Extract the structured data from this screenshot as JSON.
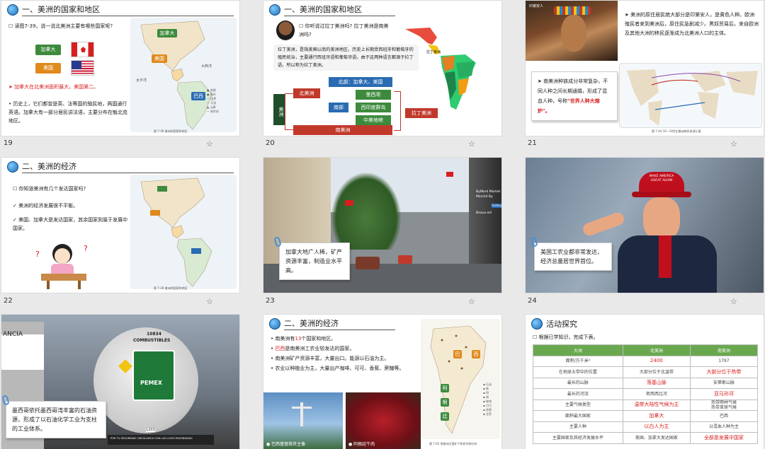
{
  "slides": [
    {
      "num": "19",
      "title": "一、美洲的国家和地区",
      "q": "读图7-39，说一说北美洲主要有哪些国家呢?",
      "labels": [
        "加拿大",
        "美国"
      ],
      "point1": "➤ 加拿大在北美洲面积最大，美国第二。",
      "point2": "历史上，它们都曾是英、法等国的殖民地，两国通行英语。加拿大有一部分居民讲法语，主要分布在魁北克地区。",
      "caption": "图 7-39   美洲的国家和地区",
      "map_labels": [
        "加拿大",
        "美国",
        "巴西"
      ]
    },
    {
      "num": "20",
      "title": "一、美洲的国家和地区",
      "q": "你听说过拉丁美洲吗? 拉丁美洲是南美洲吗?",
      "para": "拉丁美洲，是指美国以南的美洲地区。历史上长期受西班牙和葡萄牙的殖民统治，主要通行西班牙语和葡萄牙语。由于这两种语言都源于拉丁语，所以称为拉丁美洲。",
      "tree": {
        "root": "美洲",
        "na": "北美洲",
        "na_top": "北部：加拿大、美国",
        "south": "南部",
        "mex": "墨西哥",
        "wi": "西印度群岛",
        "ca": "中美地峡",
        "sa": "南美洲",
        "latin": "拉丁美洲"
      },
      "map_caption": "拉丁美洲"
    },
    {
      "num": "21",
      "tag": "印第安人",
      "p1": "美洲的原住居民绝大部分是印第安人，是黄色人种。欧洲殖民者来到美洲后，原住民急剧减少。黑奴贸易后，来自欧洲及其他大洲的移民逐渐成为北美洲人口的主体。",
      "p2a": "南美洲种族成分非常复杂，不同人种之间长期通婚，形成了混血人种，号称",
      "p2b": "\"世界人种大熔炉\"。",
      "caption": "图 7-44   16—19世纪美洲移民来源示意"
    },
    {
      "num": "22",
      "title": "二、美洲的经济",
      "q": "你知道美洲有几个发达国家吗?",
      "c1": "✓ 美洲的经济发展很不平衡。",
      "c2": "✓ 美国、加拿大是发达国家，其余国家则属于发展中国家。",
      "caption": "图 7-39   美洲的国家和地区"
    },
    {
      "num": "23",
      "note": "加拿大地广人稀，矿产资源丰富，制造业水平高。",
      "signs": [
        "ByWord Market",
        "Marché By",
        "Gallery",
        "Beaux-art"
      ]
    },
    {
      "num": "24",
      "note": "美国工农业都非常发达，经济总量居世界首位。",
      "hat": "MAKE AMERICA GREAT AGAIN"
    },
    {
      "num": "25",
      "note": "墨西哥依托墨西哥湾丰富的石油资源，形成了以石油化学工业为支柱的工业体系。",
      "truck": {
        "id": "10834",
        "word": "COMBUSTIBLES",
        "brand": "PEMEX",
        "plate": "1203",
        "banner": "POR TU SEGURIDAD CIRCULAMOS CON LAS LUCES ENCENDIDAS"
      },
      "sign": "ANCIA"
    },
    {
      "num": "26",
      "title": "二、美洲的经济",
      "b1a": "南美洲有",
      "b1n": "13",
      "b1b": "个国家和地区。",
      "b2a": "巴西",
      "b2b": "是南美洲工农业较发达的国家。",
      "b3": "南美洲矿产资源丰富，大量出口。能源以石油为主。",
      "b4": "农业以种植业为主，大量出产咖啡、可可、香蕉、蔗糖等。",
      "photo1": "巴西基督救世主像",
      "photo2": "阿根廷牛肉",
      "map_tags": [
        "巴",
        "西",
        "阿",
        "根",
        "廷"
      ],
      "caption": "图 7-62   南美洲主要矿产和农作物分布"
    },
    {
      "num": "27",
      "title": "活动探究",
      "q": "根据已学知识，完成下表。",
      "head": [
        "大洲",
        "北美洲",
        "南美洲"
      ],
      "rows": [
        [
          "面积/万千米²",
          "2400",
          "1797"
        ],
        [
          "在地球五带中的位置",
          "大部分位于北温带",
          "大部分位于热带"
        ],
        [
          "最长的山脉",
          "落基山脉",
          "安第斯山脉"
        ],
        [
          "最长的河流",
          "密西西比河",
          "亚马孙河"
        ],
        [
          "主要气候类型",
          "温带大陆性气候为主",
          "热带雨林气候\n热带草原气候"
        ],
        [
          "面积最大国家",
          "加拿大",
          "巴西"
        ],
        [
          "主要人种",
          "以白人为主",
          "以混血人种为主"
        ],
        [
          "主要国家及其经济发展水平",
          "美国、加拿大发达国家",
          "全部是发展中国家"
        ]
      ],
      "red_cells": [
        [
          0,
          1
        ],
        [
          1,
          2
        ],
        [
          2,
          1
        ],
        [
          3,
          2
        ],
        [
          4,
          1
        ],
        [
          5,
          1
        ],
        [
          6,
          1
        ],
        [
          7,
          2
        ]
      ]
    }
  ],
  "colors": {
    "red": "#d81e1e",
    "green": "#3d8a3d",
    "blue": "#2a6bb3",
    "orange": "#e08a1e"
  }
}
